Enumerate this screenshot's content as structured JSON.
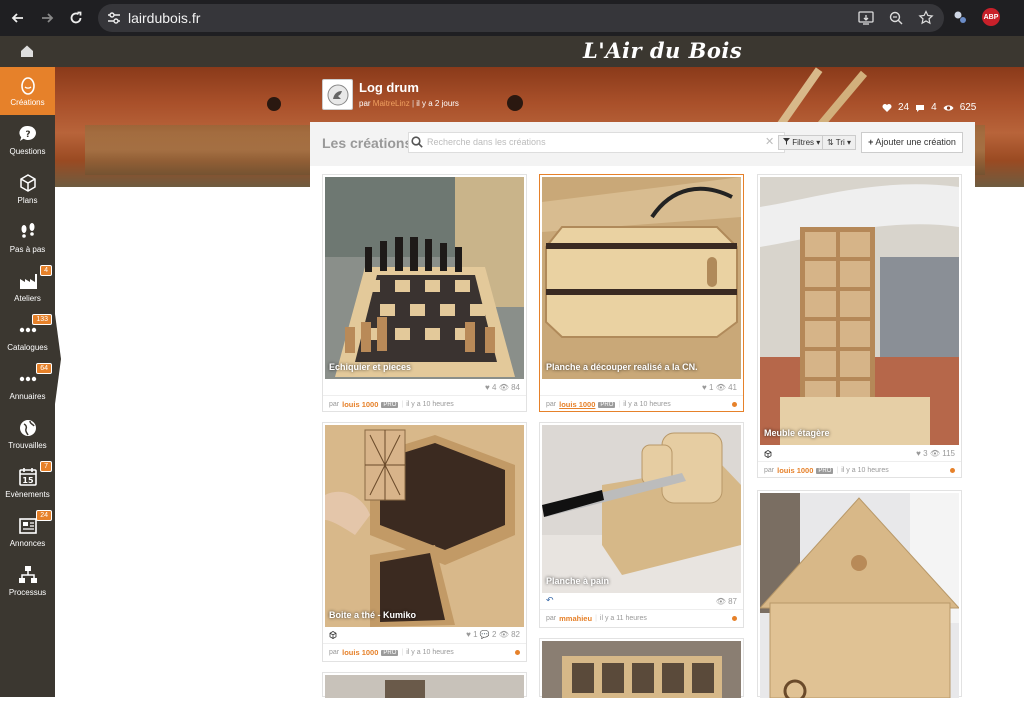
{
  "browser": {
    "url": "lairdubois.fr"
  },
  "site": {
    "logo": "L'Air du Bois"
  },
  "sidebar": {
    "items": [
      {
        "label": "Créations",
        "badge": ""
      },
      {
        "label": "Questions",
        "badge": ""
      },
      {
        "label": "Plans",
        "badge": ""
      },
      {
        "label": "Pas à pas",
        "badge": ""
      },
      {
        "label": "Ateliers",
        "badge": "4"
      },
      {
        "label": "Catalogues",
        "badge": "133"
      },
      {
        "label": "Annuaires",
        "badge": "64"
      },
      {
        "label": "Trouvailles",
        "badge": ""
      },
      {
        "label": "Evènements",
        "badge": "7"
      },
      {
        "label": "Annonces",
        "badge": "24"
      },
      {
        "label": "Processus",
        "badge": ""
      }
    ]
  },
  "post": {
    "title": "Log drum",
    "by": "par",
    "author": "MaitreLinz",
    "time": "il y a 2 jours",
    "likes": "24",
    "comments": "4",
    "views": "625"
  },
  "creations": {
    "heading": "Les créations",
    "search_placeholder": "Recherche dans les créations",
    "filters_label": "Filtres",
    "sort_label": "Tri",
    "add_label": "Ajouter une création"
  },
  "cards": [
    {
      "title": "Echiquier et pieces",
      "likes": "4",
      "comments": "",
      "views": "84",
      "by": "par",
      "author": "louis 1000",
      "pro": "PRO",
      "time": "il y a 10 heures"
    },
    {
      "title": "Planche a découper realisé a la CN.",
      "likes": "1",
      "comments": "",
      "views": "41",
      "by": "par",
      "author": "louis 1000",
      "pro": "PRO",
      "time": "il y a 10 heures"
    },
    {
      "title": "Meuble étagère",
      "likes": "3",
      "comments": "",
      "views": "115",
      "by": "par",
      "author": "louis 1000",
      "pro": "PRO",
      "time": "il y a 10 heures"
    },
    {
      "title": "Boite a thé - Kumiko",
      "likes": "1",
      "comments": "2",
      "views": "82",
      "by": "par",
      "author": "louis 1000",
      "pro": "PRO",
      "time": "il y a 10 heures"
    },
    {
      "title": "Planche à pain",
      "likes": "",
      "comments": "",
      "views": "87",
      "by": "par",
      "author": "mmahieu",
      "pro": "",
      "time": "il y a 11 heures"
    }
  ],
  "colors": {
    "accent": "#e6812a",
    "sidebar": "#3b3730",
    "browser": "#1f1f22"
  }
}
